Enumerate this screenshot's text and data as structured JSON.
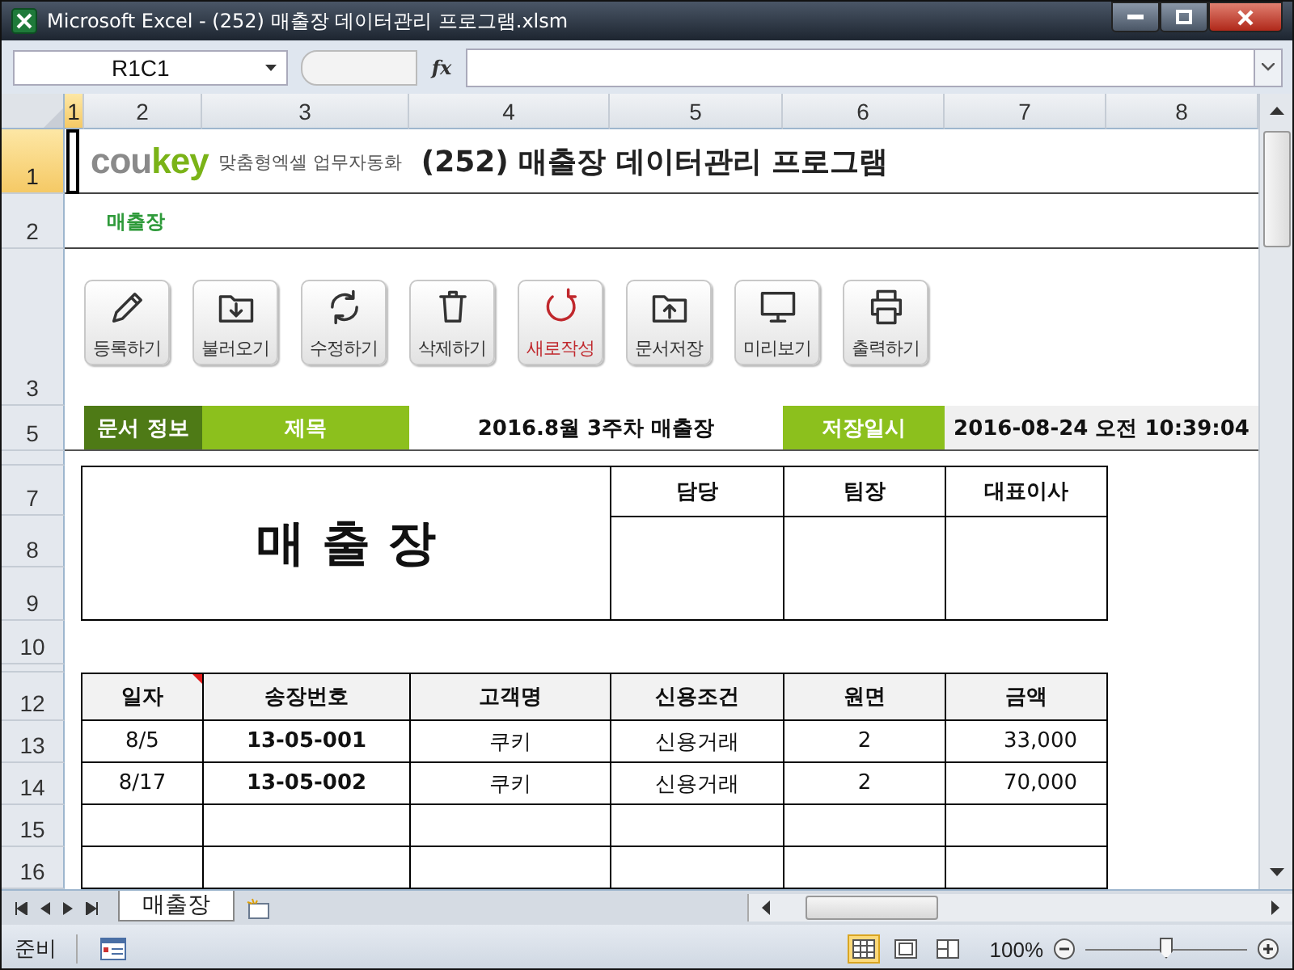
{
  "window": {
    "title": "Microsoft Excel - (252) 매출장 데이터관리 프로그램.xlsm"
  },
  "formula_bar": {
    "name_box": "R1C1",
    "fx_label": "fx"
  },
  "column_headers": [
    {
      "label": "1",
      "selected": true
    },
    {
      "label": "2",
      "selected": false
    },
    {
      "label": "3",
      "selected": false
    },
    {
      "label": "4",
      "selected": false
    },
    {
      "label": "5",
      "selected": false
    },
    {
      "label": "6",
      "selected": false
    },
    {
      "label": "7",
      "selected": false
    },
    {
      "label": "8",
      "selected": false
    }
  ],
  "row_headers": [
    {
      "label": "1",
      "selected": true
    },
    {
      "label": "2",
      "selected": false
    },
    {
      "label": "3",
      "selected": false
    },
    {
      "label": "5",
      "selected": false
    },
    {
      "label": "7",
      "selected": false
    },
    {
      "label": "8",
      "selected": false
    },
    {
      "label": "9",
      "selected": false
    },
    {
      "label": "10",
      "selected": false
    },
    {
      "label": "12",
      "selected": false
    },
    {
      "label": "13",
      "selected": false
    },
    {
      "label": "14",
      "selected": false
    },
    {
      "label": "15",
      "selected": false
    },
    {
      "label": "16",
      "selected": false
    }
  ],
  "header": {
    "logo": {
      "text": "cou",
      "accent": "key"
    },
    "tagline": "맞춤형엑셀 업무자동화",
    "title": "(252) 매출장 데이터관리 프로그램",
    "sheet_label": "매출장"
  },
  "buttons": [
    {
      "label": "등록하기",
      "color": "#333333"
    },
    {
      "label": "불러오기",
      "color": "#333333"
    },
    {
      "label": "수정하기",
      "color": "#333333"
    },
    {
      "label": "삭제하기",
      "color": "#333333"
    },
    {
      "label": "새로작성",
      "color": "#c0282d"
    },
    {
      "label": "문서저장",
      "color": "#333333"
    },
    {
      "label": "미리보기",
      "color": "#333333"
    },
    {
      "label": "출력하기",
      "color": "#333333"
    }
  ],
  "doc_info": {
    "section": "문서 정보",
    "title_label": "제목",
    "title_value": "2016.8월 3주차 매출장",
    "saved_label": "저장일시",
    "saved_value": "2016-08-24 오전 10:39:04"
  },
  "form": {
    "heading": "매 출 장",
    "approvals": [
      "담당",
      "팀장",
      "대표이사"
    ]
  },
  "table": {
    "columns": [
      {
        "label": "일자",
        "comment": true
      },
      {
        "label": "송장번호",
        "comment": false
      },
      {
        "label": "고객명",
        "comment": false
      },
      {
        "label": "신용조건",
        "comment": false
      },
      {
        "label": "원면",
        "comment": false
      },
      {
        "label": "금액",
        "comment": false
      }
    ],
    "rows": [
      [
        "8/5",
        "13-05-001",
        "쿠키",
        "신용거래",
        "2",
        "33,000"
      ],
      [
        "8/17",
        "13-05-002",
        "쿠키",
        "신용거래",
        "2",
        "70,000"
      ]
    ]
  },
  "sheet_tabs": [
    {
      "label": "매출장",
      "selected": true
    }
  ],
  "status_bar": {
    "status": "준비",
    "views": [
      {
        "kind": "normal",
        "selected": true
      },
      {
        "kind": "page_layout",
        "selected": false
      },
      {
        "kind": "page_break",
        "selected": false
      }
    ],
    "zoom": "100%",
    "zoom_slider": {
      "level": 0.5
    }
  }
}
